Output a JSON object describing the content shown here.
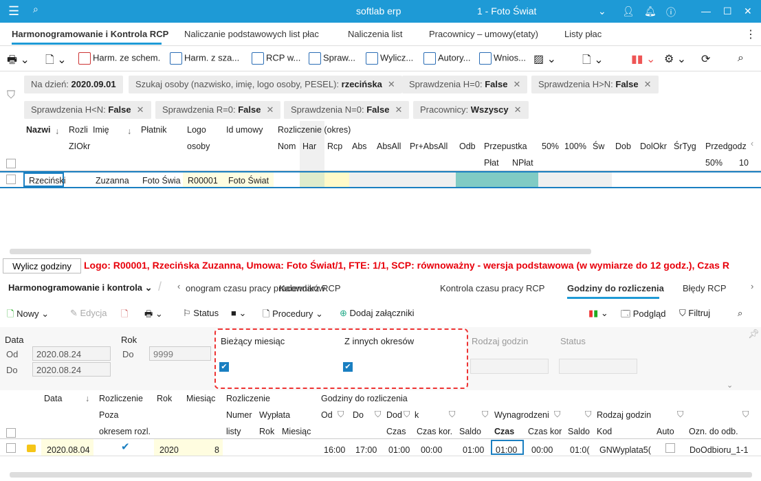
{
  "titlebar": {
    "app": "softlab erp",
    "company": "1 - Foto Świat"
  },
  "tabs": [
    "Harmonogramowanie i Kontrola RCP",
    "Naliczanie podstawowych list płac",
    "Naliczenia list",
    "Pracownicy – umowy(etaty)",
    "Listy płac"
  ],
  "toolbar": [
    "Harm. ze schem.",
    "Harm. z sza...",
    "RCP w...",
    "Spraw...",
    "Wylicz...",
    "Autory...",
    "Wnios..."
  ],
  "filters": [
    {
      "label": "Na dzień:",
      "value": "2020.09.01",
      "closable": false
    },
    {
      "label": "Szukaj osoby (nazwisko, imię, logo osoby, PESEL):",
      "value": "rzecińska",
      "closable": true
    },
    {
      "label": "Sprawdzenia  H=0:",
      "value": "False",
      "closable": true
    },
    {
      "label": "Sprawdzenia  H>N:",
      "value": "False",
      "closable": true
    },
    {
      "label": "Sprawdzenia  H<N:",
      "value": "False",
      "closable": true
    },
    {
      "label": "Sprawdzenia  R=0:",
      "value": "False",
      "closable": true
    },
    {
      "label": "Sprawdzenia  N=0:",
      "value": "False",
      "closable": true
    },
    {
      "label": "Pracownicy:",
      "value": "Wszyscy",
      "closable": true
    }
  ],
  "grid1": {
    "headers": [
      "Nazwi",
      "Rozli",
      "Imię",
      "Płatnik",
      "Logo",
      "Id umowy",
      "Rozliczenie (okres)",
      "ZIOkr",
      "osoby",
      "Nom",
      "Har",
      "Rcp",
      "Abs",
      "AbsAll",
      "Pr+AbsAll",
      "Odb",
      "Przepustka",
      "50%",
      "100%",
      "Św",
      "Dob",
      "DolOkr",
      "ŚrTyg",
      "Przedgodz",
      "Płat",
      "NPłat",
      "50%",
      "10"
    ],
    "row": [
      "Rzeciński",
      "Zuzanna",
      "Foto Świa",
      "R00001",
      "Foto Świat"
    ]
  },
  "wylicz": "Wylicz godziny",
  "info": "Logo: R00001, Rzecińska Zuzanna, Umowa: Foto Świat/1, FTE: 1/1, SCP: równoważny - wersja podstawowa (w wymiarze do 12 godz.), Czas R",
  "section": "Harmonogramowanie i kontrola",
  "tabs2": [
    "onogram czasu pracy pracowników",
    "Kalendarz RCP",
    "Kontrola czasu pracy RCP",
    "Godziny do rozliczenia",
    "Błędy RCP"
  ],
  "toolbar2": {
    "new": "Nowy",
    "edit": "Edycja",
    "status": "Status",
    "procedures": "Procedury",
    "attach": "Dodaj załączniki",
    "preview": "Podgląd",
    "filter": "Filtruj"
  },
  "panel": {
    "data": "Data",
    "od": "Od",
    "do": "Do",
    "od_value": "2020.08.24",
    "do_value": "2020.08.24",
    "rok": "Rok",
    "rok_do": "Do",
    "rok_value": "9999",
    "current": "Bieżący miesiąc",
    "other": "Z innych okresów",
    "rodzaj": "Rodzaj godzin",
    "status": "Status"
  },
  "grid2": {
    "headers": [
      "Data",
      "Rozliczenie",
      "Rok",
      "Miesiąc",
      "Rozliczenie",
      "Godziny do rozliczenia",
      "Poza",
      "Numer",
      "Wypłata",
      "Od",
      "Do",
      "Dod",
      "k",
      "Wynagrodzeni",
      "Rodzaj godzin",
      "okresem rozl.",
      "listy",
      "Rok",
      "Miesiąc",
      "Czas",
      "Czas kor.",
      "Saldo",
      "Czas",
      "Czas kor",
      "Saldo",
      "Kod",
      "Auto",
      "Ozn. do odb."
    ],
    "row": [
      "2020.08.04",
      "2020",
      "8",
      "16:00",
      "17:00",
      "01:00",
      "00:00",
      "01:00",
      "01:00",
      "00:00",
      "01:0(",
      "GNWyplata5(",
      "DoOdbioru_1-1"
    ]
  },
  "colors": {
    "accent": "#1e9ad6",
    "error": "#e8000b"
  }
}
